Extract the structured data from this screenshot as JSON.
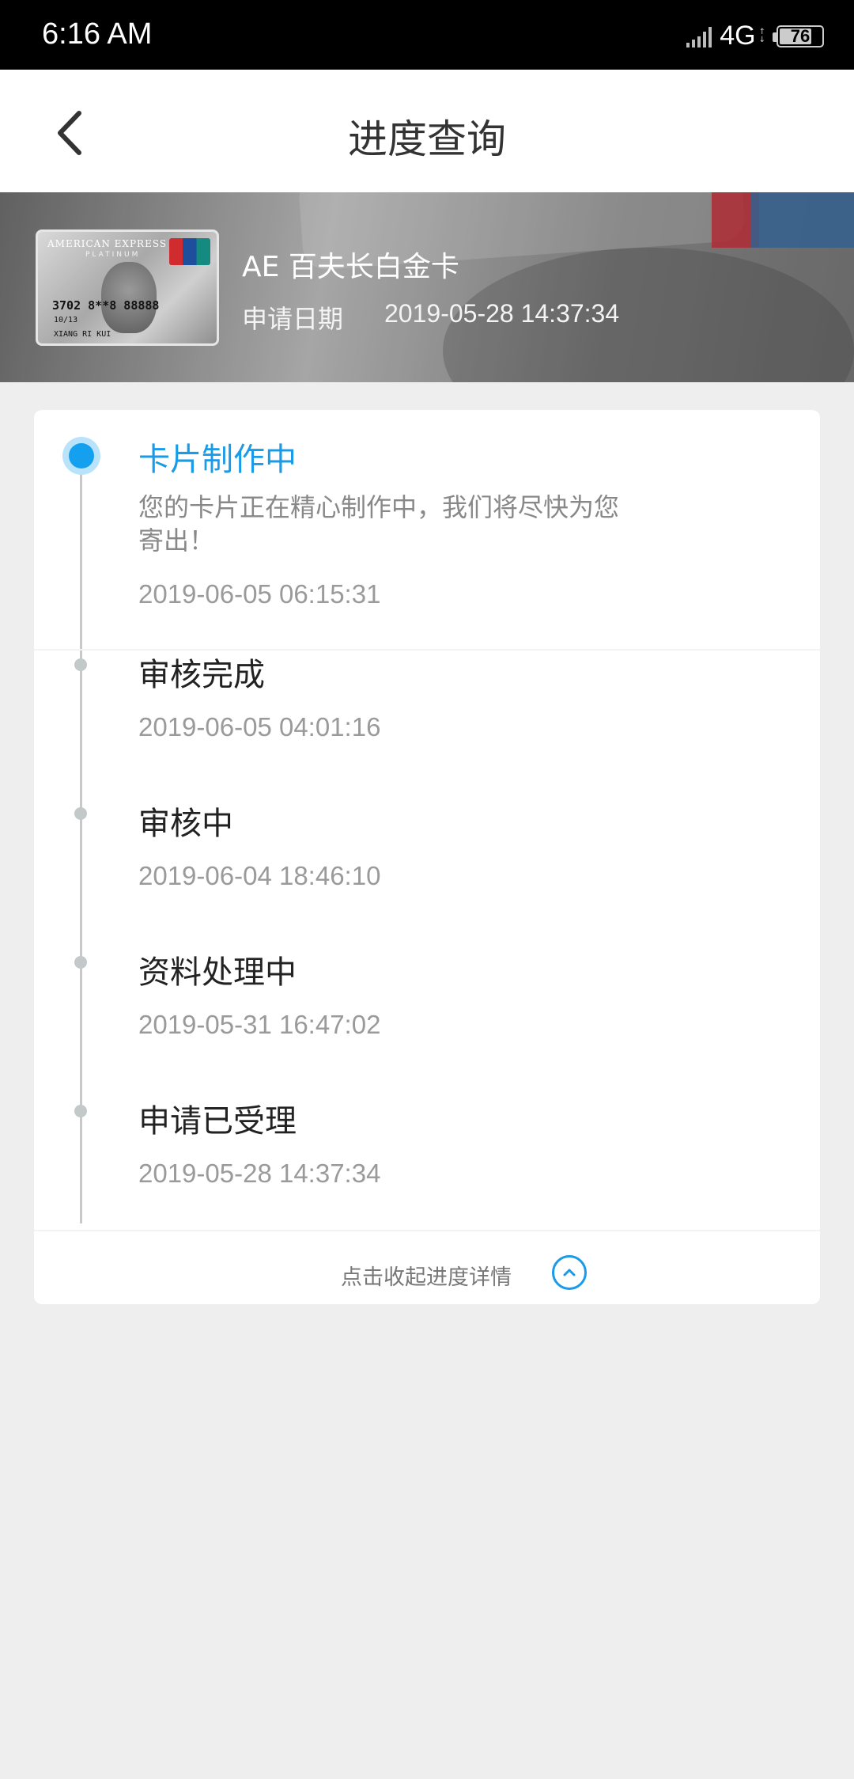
{
  "status_bar": {
    "time": "6:16  AM",
    "network": "4G",
    "battery": "76"
  },
  "header": {
    "title": "进度查询"
  },
  "card": {
    "name": "AE 百夫长白金卡",
    "apply_label": "申请日期",
    "apply_date": "2019-05-28 14:37:34",
    "thumb": {
      "brand": "AMERICAN EXPRESS",
      "tier": "PLATINUM",
      "number": "3702 8**8 88888",
      "expiry": "10/13",
      "holder": "XIANG RI KUI"
    }
  },
  "timeline": {
    "steps": [
      {
        "title": "卡片制作中",
        "desc": "您的卡片正在精心制作中，我们将尽快为您寄出！",
        "time": "2019-06-05 06:15:31",
        "active": true
      },
      {
        "title": "审核完成",
        "time": "2019-06-05 04:01:16"
      },
      {
        "title": "审核中",
        "time": "2019-06-04 18:46:10"
      },
      {
        "title": "资料处理中",
        "time": "2019-05-31 16:47:02"
      },
      {
        "title": "申请已受理",
        "time": "2019-05-28 14:37:34"
      }
    ],
    "collapse_label": "点击收起进度详情"
  },
  "colors": {
    "accent": "#1a9be8",
    "background": "#eeeeee"
  }
}
